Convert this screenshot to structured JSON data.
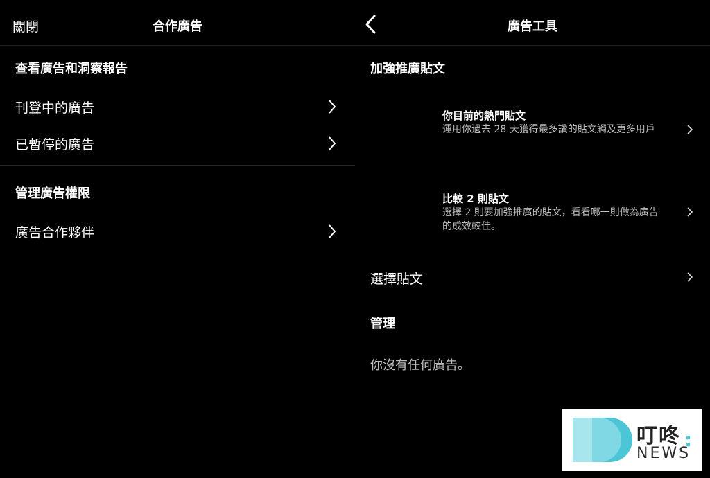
{
  "left": {
    "header": {
      "close_label": "關閉",
      "title": "合作廣告"
    },
    "section1": {
      "heading": "查看廣告和洞察報告",
      "items": [
        {
          "label": "刊登中的廣告"
        },
        {
          "label": "已暫停的廣告"
        }
      ]
    },
    "section2": {
      "heading": "管理廣告權限",
      "items": [
        {
          "label": "廣告合作夥伴"
        }
      ]
    }
  },
  "right": {
    "header": {
      "title": "廣告工具"
    },
    "boost": {
      "heading": "加強推廣貼文",
      "cards": [
        {
          "title": "你目前的熱門貼文",
          "desc": "運用你過去 28 天獲得最多讚的貼文觸及更多用戶"
        },
        {
          "title": "比較 2 則貼文",
          "desc": "選擇 2 則要加強推廣的貼文，看看哪一則做為廣告的成效較佳。"
        }
      ],
      "select_post_label": "選擇貼文"
    },
    "manage": {
      "heading": "管理",
      "empty_text": "你沒有任何廣告。"
    }
  },
  "watermark": {
    "name_cn": "叮咚",
    "colon": ":",
    "name_en": "NEWS"
  },
  "colors": {
    "background": "#000000",
    "muted_text": "#bdbdbd",
    "logo_accent": "#4cc6d6"
  },
  "icons": [
    "chevron-left-icon",
    "chevron-right-icon"
  ]
}
